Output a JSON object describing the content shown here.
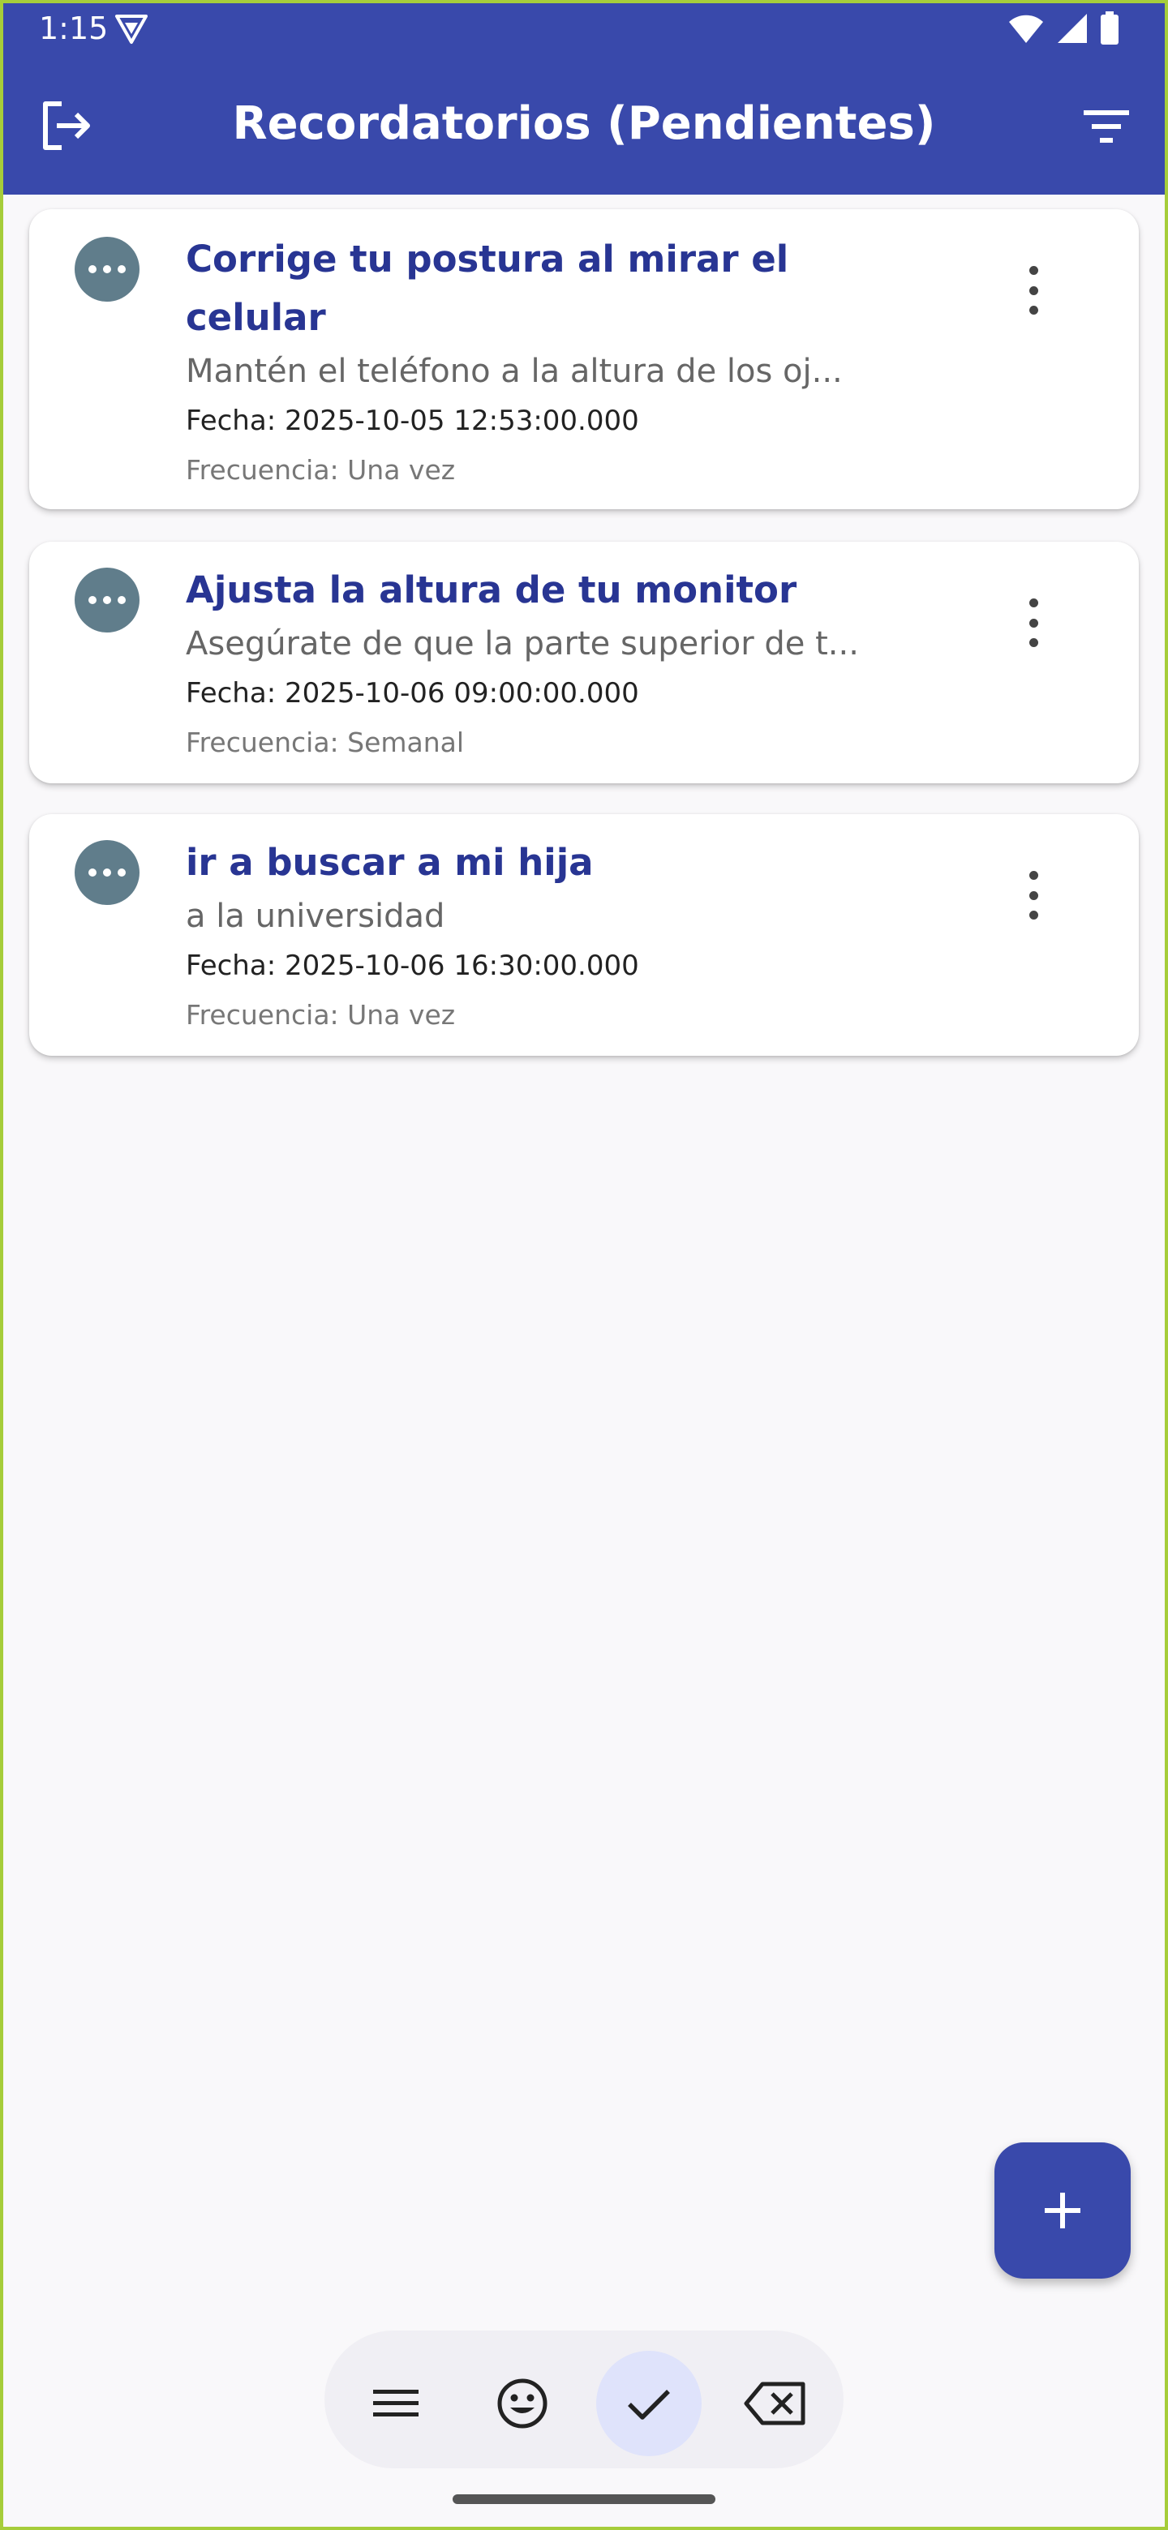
{
  "status_bar": {
    "time": "1:15"
  },
  "app_bar": {
    "title": "Recordatorios (Pendientes)",
    "left_icon": "logout-icon",
    "right_icon": "filter-icon"
  },
  "reminders": [
    {
      "title_line1": "Corrige tu postura al mirar el",
      "title_line2": "celular",
      "description": "Mantén el teléfono a la altura de los oj...",
      "date": "Fecha: 2025-10-05 12:53:00.000",
      "frequency": "Frecuencia: Una vez"
    },
    {
      "title_line1": "Ajusta la altura de tu monitor",
      "description": "Asegúrate de que la parte superior de t...",
      "date": "Fecha: 2025-10-06 09:00:00.000",
      "frequency": "Frecuencia: Semanal"
    },
    {
      "title_line1": "ir a buscar a mi hija",
      "description": "a la universidad",
      "date": "Fecha: 2025-10-06 16:30:00.000",
      "frequency": "Frecuencia: Una vez"
    }
  ],
  "fab": {
    "icon": "plus-icon"
  },
  "bottom_nav": {
    "items": [
      {
        "icon": "menu-icon",
        "active": false
      },
      {
        "icon": "smile-icon",
        "active": false
      },
      {
        "icon": "check-icon",
        "active": true
      },
      {
        "icon": "backspace-icon",
        "active": false
      }
    ]
  },
  "colors": {
    "primary": "#3949ab",
    "title_text": "#283593",
    "avatar": "#607d8b",
    "active_nav": "#dfe3fb",
    "background": "#f9f8fa"
  }
}
